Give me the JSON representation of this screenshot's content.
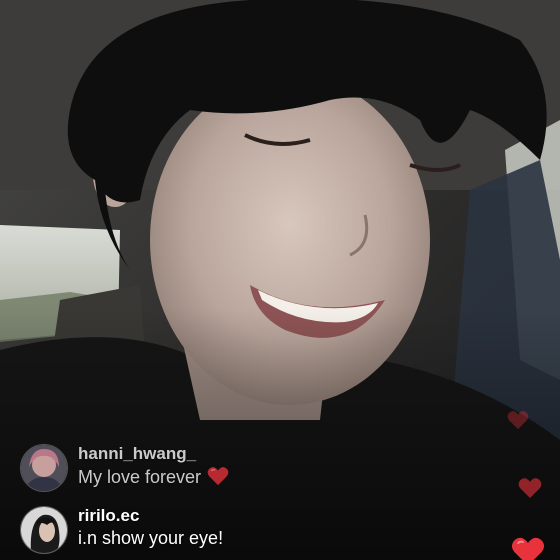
{
  "stream": {
    "comments": [
      {
        "username": "hanni_hwang_",
        "message": "My love forever",
        "has_heart": true,
        "avatar": "pink-haired-profile-avatar"
      },
      {
        "username": "ririlo.ec",
        "message": "i.n show your eye!",
        "has_heart": false,
        "avatar": "dark-haired-profile-avatar"
      }
    ]
  },
  "icons": {
    "message_heart": "heart-emoji-icon",
    "floating_hearts": "heart-reaction-icon"
  },
  "colors": {
    "heart": "#e8323c",
    "comment_text": "#ffffff"
  }
}
